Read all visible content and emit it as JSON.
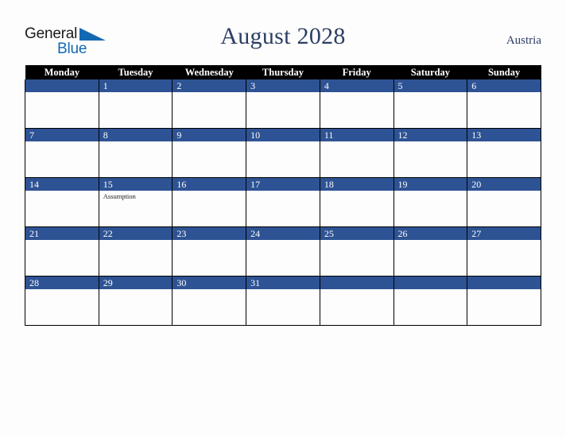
{
  "brand": {
    "name_part1": "General",
    "name_part2": "Blue",
    "flag_icon": "triangle-flag-icon"
  },
  "header": {
    "title": "August 2028",
    "country": "Austria"
  },
  "colors": {
    "accent_blue": "#2e5394",
    "header_black": "#000000",
    "title_navy": "#2c3e63",
    "logo_blue": "#1268b3",
    "page_background": "#fdfdfd"
  },
  "calendar": {
    "month": "August",
    "year": "2028",
    "weekday_headers": [
      "Monday",
      "Tuesday",
      "Wednesday",
      "Thursday",
      "Friday",
      "Saturday",
      "Sunday"
    ],
    "weeks": [
      [
        {
          "day": "",
          "events": []
        },
        {
          "day": "1",
          "events": []
        },
        {
          "day": "2",
          "events": []
        },
        {
          "day": "3",
          "events": []
        },
        {
          "day": "4",
          "events": []
        },
        {
          "day": "5",
          "events": []
        },
        {
          "day": "6",
          "events": []
        }
      ],
      [
        {
          "day": "7",
          "events": []
        },
        {
          "day": "8",
          "events": []
        },
        {
          "day": "9",
          "events": []
        },
        {
          "day": "10",
          "events": []
        },
        {
          "day": "11",
          "events": []
        },
        {
          "day": "12",
          "events": []
        },
        {
          "day": "13",
          "events": []
        }
      ],
      [
        {
          "day": "14",
          "events": []
        },
        {
          "day": "15",
          "events": [
            "Assumption"
          ]
        },
        {
          "day": "16",
          "events": []
        },
        {
          "day": "17",
          "events": []
        },
        {
          "day": "18",
          "events": []
        },
        {
          "day": "19",
          "events": []
        },
        {
          "day": "20",
          "events": []
        }
      ],
      [
        {
          "day": "21",
          "events": []
        },
        {
          "day": "22",
          "events": []
        },
        {
          "day": "23",
          "events": []
        },
        {
          "day": "24",
          "events": []
        },
        {
          "day": "25",
          "events": []
        },
        {
          "day": "26",
          "events": []
        },
        {
          "day": "27",
          "events": []
        }
      ],
      [
        {
          "day": "28",
          "events": []
        },
        {
          "day": "29",
          "events": []
        },
        {
          "day": "30",
          "events": []
        },
        {
          "day": "31",
          "events": []
        },
        {
          "day": "",
          "events": []
        },
        {
          "day": "",
          "events": []
        },
        {
          "day": "",
          "events": []
        }
      ]
    ]
  }
}
